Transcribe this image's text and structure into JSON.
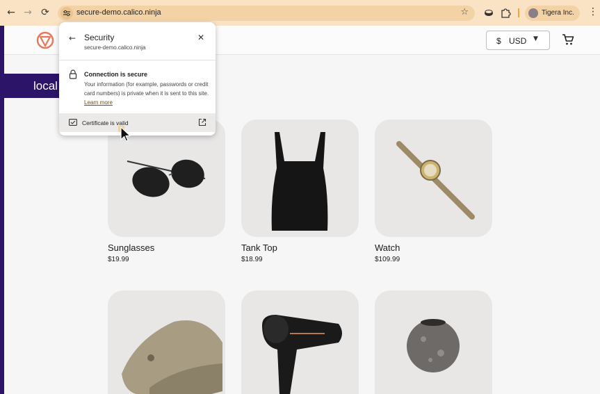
{
  "browser": {
    "url": "secure-demo.calico.ninja",
    "profile_name": "Tigera Inc.",
    "icons": [
      "back-arrow-icon",
      "forward-arrow-icon",
      "reload-icon",
      "site-info-icon",
      "star-icon",
      "extension-icon",
      "puzzle-icon",
      "kebab-menu-icon"
    ]
  },
  "header": {
    "currency_symbol": "$",
    "currency_code": "USD",
    "banner_text": "local"
  },
  "security_popup": {
    "title": "Security",
    "domain": "secure-demo.calico.ninja",
    "connection_title": "Connection is secure",
    "connection_desc": "Your information (for example, passwords or credit card numbers) is private when it is sent to this site.",
    "learn_more": "Learn more",
    "certificate_label": "Certificate is valid"
  },
  "products": [
    {
      "name": "Sunglasses",
      "price": "$19.99"
    },
    {
      "name": "Tank Top",
      "price": "$18.99"
    },
    {
      "name": "Watch",
      "price": "$109.99"
    },
    {
      "name": "",
      "price": ""
    },
    {
      "name": "",
      "price": ""
    },
    {
      "name": "",
      "price": ""
    }
  ],
  "colors": {
    "chrome_bar": "#f9e3c4",
    "omnibox": "#f3d3a6",
    "brand_purple": "#2c1468",
    "logo_accent": "#e8775a"
  }
}
